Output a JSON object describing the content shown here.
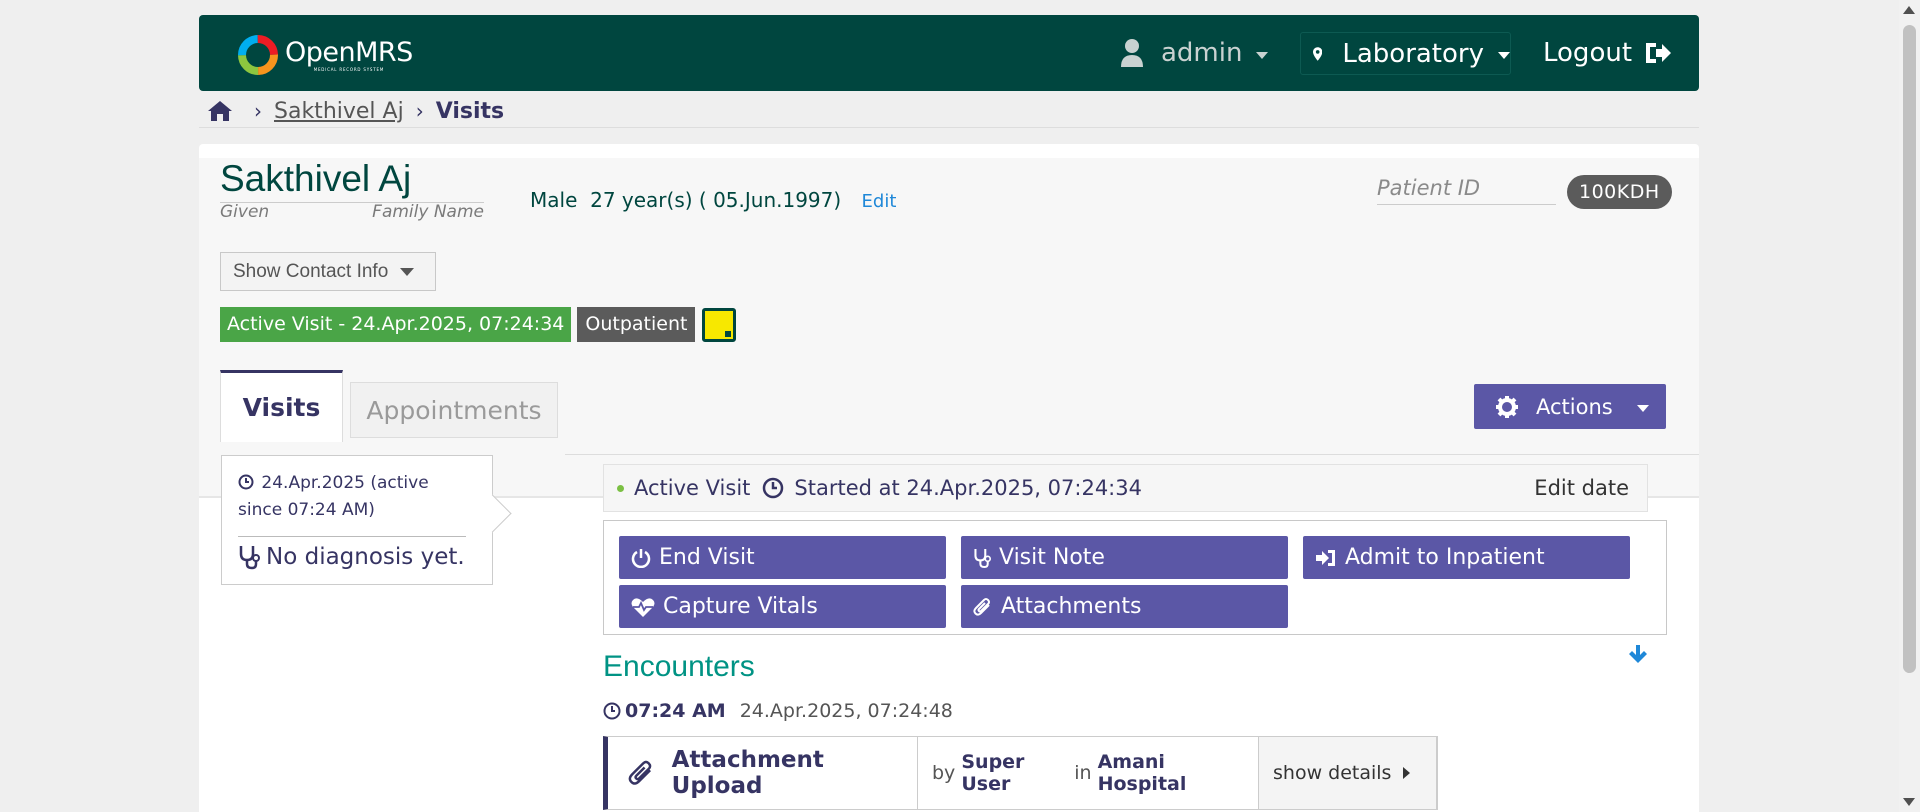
{
  "header": {
    "logo_text": "OpenMRS",
    "logo_subtitle": "MEDICAL RECORD SYSTEM",
    "user": "admin",
    "location": "Laboratory",
    "logout": "Logout",
    "bg_color": "#00463f"
  },
  "breadcrumb": {
    "patient": "Sakthivel Aj",
    "current": "Visits"
  },
  "patient": {
    "name": "Sakthivel Aj",
    "given_label": "Given",
    "family_label": "Family Name",
    "gender": "Male",
    "age": "27 year(s) ( 05.Jun.1997)",
    "edit_label": "Edit",
    "patient_id_label": "Patient ID",
    "patient_id": "100KDH",
    "show_contact": "Show Contact Info",
    "active_visit_badge": "Active Visit - 24.Apr.2025, 07:24:34",
    "visit_type": "Outpatient"
  },
  "tabs": [
    {
      "label": "Visits",
      "active": true
    },
    {
      "label": "Appointments",
      "active": false
    }
  ],
  "actions_button": "Actions",
  "visit_list": {
    "date": "24.Apr.2025 (active since 07:24 AM)",
    "diagnosis": "No diagnosis yet."
  },
  "visit_summary": {
    "status": "Active Visit",
    "started": "Started at 24.Apr.2025, 07:24:34",
    "edit_date": "Edit date"
  },
  "visit_actions": [
    {
      "label": "End Visit",
      "icon": "power-icon"
    },
    {
      "label": "Visit Note",
      "icon": "stethoscope-icon"
    },
    {
      "label": "Admit to Inpatient",
      "icon": "sign-in-icon"
    },
    {
      "label": "Capture Vitals",
      "icon": "heartbeat-icon"
    },
    {
      "label": "Attachments",
      "icon": "paperclip-icon"
    }
  ],
  "encounters": {
    "title": "Encounters",
    "time": "07:24 AM",
    "timestamp": "24.Apr.2025, 07:24:48",
    "items": [
      {
        "type": "Attachment Upload",
        "by_prefix": "by",
        "provider": "Super User",
        "in_label": "in",
        "location": "Amani Hospital",
        "show_details": "show details"
      }
    ]
  },
  "colors": {
    "primary": "#5b57a6",
    "active_visit": "#4aa547",
    "encounters_title": "#009384"
  }
}
